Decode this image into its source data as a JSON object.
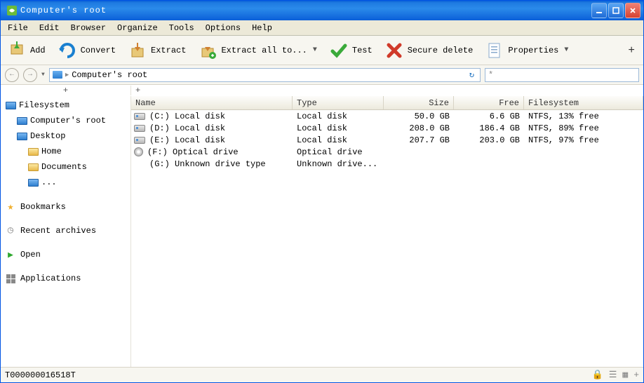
{
  "title": "Computer's root",
  "menu": [
    "File",
    "Edit",
    "Browser",
    "Organize",
    "Tools",
    "Options",
    "Help"
  ],
  "toolbar": {
    "add": "Add",
    "convert": "Convert",
    "extract": "Extract",
    "extract_all": "Extract all to...",
    "test": "Test",
    "secure_delete": "Secure delete",
    "properties": "Properties"
  },
  "address": {
    "path": "Computer's root"
  },
  "search": {
    "placeholder": "*"
  },
  "sidebar": {
    "filesystem": "Filesystem",
    "tree": [
      "Computer's root",
      "Desktop",
      "Home",
      "Documents",
      "..."
    ],
    "bookmarks": "Bookmarks",
    "recent": "Recent archives",
    "open": "Open",
    "apps": "Applications"
  },
  "columns": {
    "name": "Name",
    "type": "Type",
    "size": "Size",
    "free": "Free",
    "fs": "Filesystem"
  },
  "rows": [
    {
      "icon": "disk",
      "name": "(C:) Local disk",
      "type": "Local disk",
      "size": "50.0 GB",
      "free": "6.6 GB",
      "fs": "NTFS, 13% free"
    },
    {
      "icon": "disk",
      "name": "(D:) Local disk",
      "type": "Local disk",
      "size": "208.0 GB",
      "free": "186.4 GB",
      "fs": "NTFS, 89% free"
    },
    {
      "icon": "disk",
      "name": "(E:) Local disk",
      "type": "Local disk",
      "size": "207.7 GB",
      "free": "203.0 GB",
      "fs": "NTFS, 97% free"
    },
    {
      "icon": "cd",
      "name": "(F:) Optical drive",
      "type": "Optical drive",
      "size": "",
      "free": "",
      "fs": ""
    },
    {
      "icon": "none",
      "name": "(G:) Unknown drive type",
      "type": "Unknown drive...",
      "size": "",
      "free": "",
      "fs": ""
    }
  ],
  "status": "T000000016518T"
}
